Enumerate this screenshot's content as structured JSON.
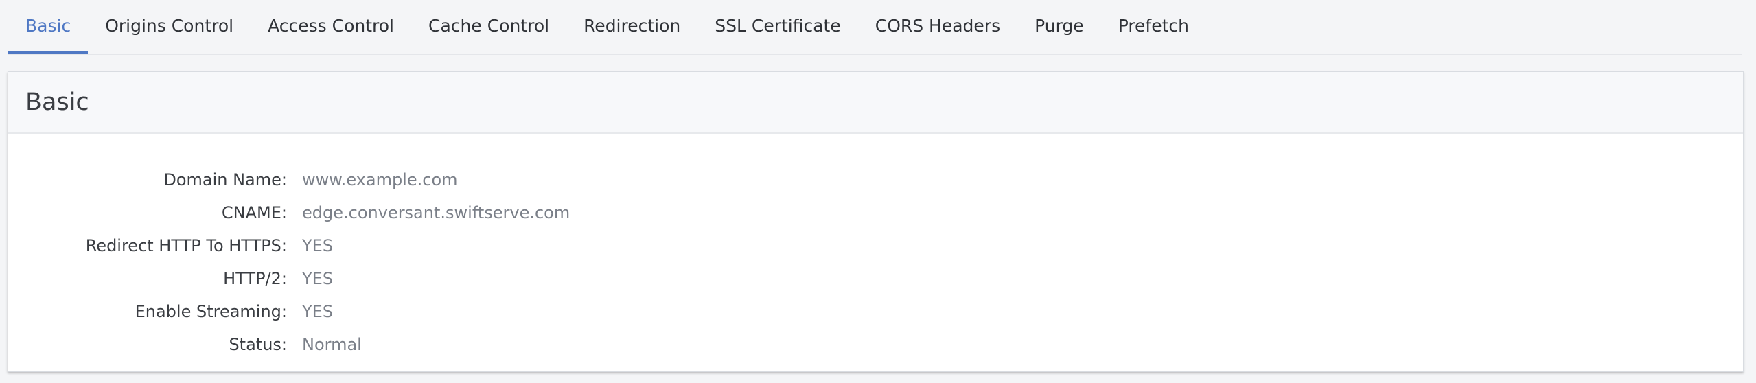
{
  "tabs": [
    {
      "label": "Basic",
      "active": true
    },
    {
      "label": "Origins Control",
      "active": false
    },
    {
      "label": "Access Control",
      "active": false
    },
    {
      "label": "Cache Control",
      "active": false
    },
    {
      "label": "Redirection",
      "active": false
    },
    {
      "label": "SSL Certificate",
      "active": false
    },
    {
      "label": "CORS Headers",
      "active": false
    },
    {
      "label": "Purge",
      "active": false
    },
    {
      "label": "Prefetch",
      "active": false
    }
  ],
  "panel": {
    "title": "Basic",
    "rows": [
      {
        "label": "Domain Name:",
        "value": "www.example.com"
      },
      {
        "label": "CNAME:",
        "value": "edge.conversant.swiftserve.com"
      },
      {
        "label": "Redirect HTTP To HTTPS:",
        "value": "YES"
      },
      {
        "label": "HTTP/2:",
        "value": "YES"
      },
      {
        "label": "Enable Streaming:",
        "value": "YES"
      },
      {
        "label": "Status:",
        "value": "Normal"
      }
    ]
  },
  "colors": {
    "accent": "#4f78c4",
    "background": "#f4f5f7",
    "card": "#ffffff",
    "label_text": "#3a3d42",
    "value_text": "#7a7f88"
  }
}
